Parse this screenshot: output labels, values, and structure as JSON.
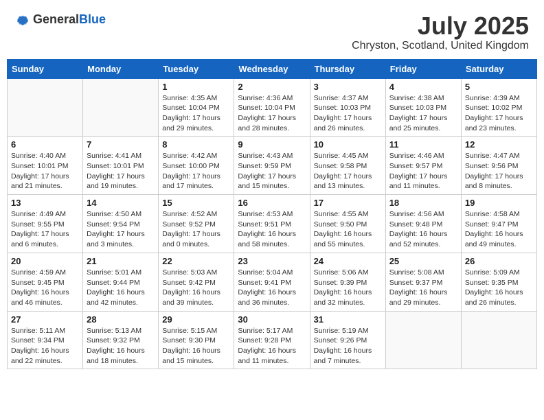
{
  "header": {
    "logo_general": "General",
    "logo_blue": "Blue",
    "title": "July 2025",
    "location": "Chryston, Scotland, United Kingdom"
  },
  "days_of_week": [
    "Sunday",
    "Monday",
    "Tuesday",
    "Wednesday",
    "Thursday",
    "Friday",
    "Saturday"
  ],
  "weeks": [
    [
      {
        "day": "",
        "info": ""
      },
      {
        "day": "",
        "info": ""
      },
      {
        "day": "1",
        "info": "Sunrise: 4:35 AM\nSunset: 10:04 PM\nDaylight: 17 hours and 29 minutes."
      },
      {
        "day": "2",
        "info": "Sunrise: 4:36 AM\nSunset: 10:04 PM\nDaylight: 17 hours and 28 minutes."
      },
      {
        "day": "3",
        "info": "Sunrise: 4:37 AM\nSunset: 10:03 PM\nDaylight: 17 hours and 26 minutes."
      },
      {
        "day": "4",
        "info": "Sunrise: 4:38 AM\nSunset: 10:03 PM\nDaylight: 17 hours and 25 minutes."
      },
      {
        "day": "5",
        "info": "Sunrise: 4:39 AM\nSunset: 10:02 PM\nDaylight: 17 hours and 23 minutes."
      }
    ],
    [
      {
        "day": "6",
        "info": "Sunrise: 4:40 AM\nSunset: 10:01 PM\nDaylight: 17 hours and 21 minutes."
      },
      {
        "day": "7",
        "info": "Sunrise: 4:41 AM\nSunset: 10:01 PM\nDaylight: 17 hours and 19 minutes."
      },
      {
        "day": "8",
        "info": "Sunrise: 4:42 AM\nSunset: 10:00 PM\nDaylight: 17 hours and 17 minutes."
      },
      {
        "day": "9",
        "info": "Sunrise: 4:43 AM\nSunset: 9:59 PM\nDaylight: 17 hours and 15 minutes."
      },
      {
        "day": "10",
        "info": "Sunrise: 4:45 AM\nSunset: 9:58 PM\nDaylight: 17 hours and 13 minutes."
      },
      {
        "day": "11",
        "info": "Sunrise: 4:46 AM\nSunset: 9:57 PM\nDaylight: 17 hours and 11 minutes."
      },
      {
        "day": "12",
        "info": "Sunrise: 4:47 AM\nSunset: 9:56 PM\nDaylight: 17 hours and 8 minutes."
      }
    ],
    [
      {
        "day": "13",
        "info": "Sunrise: 4:49 AM\nSunset: 9:55 PM\nDaylight: 17 hours and 6 minutes."
      },
      {
        "day": "14",
        "info": "Sunrise: 4:50 AM\nSunset: 9:54 PM\nDaylight: 17 hours and 3 minutes."
      },
      {
        "day": "15",
        "info": "Sunrise: 4:52 AM\nSunset: 9:52 PM\nDaylight: 17 hours and 0 minutes."
      },
      {
        "day": "16",
        "info": "Sunrise: 4:53 AM\nSunset: 9:51 PM\nDaylight: 16 hours and 58 minutes."
      },
      {
        "day": "17",
        "info": "Sunrise: 4:55 AM\nSunset: 9:50 PM\nDaylight: 16 hours and 55 minutes."
      },
      {
        "day": "18",
        "info": "Sunrise: 4:56 AM\nSunset: 9:48 PM\nDaylight: 16 hours and 52 minutes."
      },
      {
        "day": "19",
        "info": "Sunrise: 4:58 AM\nSunset: 9:47 PM\nDaylight: 16 hours and 49 minutes."
      }
    ],
    [
      {
        "day": "20",
        "info": "Sunrise: 4:59 AM\nSunset: 9:45 PM\nDaylight: 16 hours and 46 minutes."
      },
      {
        "day": "21",
        "info": "Sunrise: 5:01 AM\nSunset: 9:44 PM\nDaylight: 16 hours and 42 minutes."
      },
      {
        "day": "22",
        "info": "Sunrise: 5:03 AM\nSunset: 9:42 PM\nDaylight: 16 hours and 39 minutes."
      },
      {
        "day": "23",
        "info": "Sunrise: 5:04 AM\nSunset: 9:41 PM\nDaylight: 16 hours and 36 minutes."
      },
      {
        "day": "24",
        "info": "Sunrise: 5:06 AM\nSunset: 9:39 PM\nDaylight: 16 hours and 32 minutes."
      },
      {
        "day": "25",
        "info": "Sunrise: 5:08 AM\nSunset: 9:37 PM\nDaylight: 16 hours and 29 minutes."
      },
      {
        "day": "26",
        "info": "Sunrise: 5:09 AM\nSunset: 9:35 PM\nDaylight: 16 hours and 26 minutes."
      }
    ],
    [
      {
        "day": "27",
        "info": "Sunrise: 5:11 AM\nSunset: 9:34 PM\nDaylight: 16 hours and 22 minutes."
      },
      {
        "day": "28",
        "info": "Sunrise: 5:13 AM\nSunset: 9:32 PM\nDaylight: 16 hours and 18 minutes."
      },
      {
        "day": "29",
        "info": "Sunrise: 5:15 AM\nSunset: 9:30 PM\nDaylight: 16 hours and 15 minutes."
      },
      {
        "day": "30",
        "info": "Sunrise: 5:17 AM\nSunset: 9:28 PM\nDaylight: 16 hours and 11 minutes."
      },
      {
        "day": "31",
        "info": "Sunrise: 5:19 AM\nSunset: 9:26 PM\nDaylight: 16 hours and 7 minutes."
      },
      {
        "day": "",
        "info": ""
      },
      {
        "day": "",
        "info": ""
      }
    ]
  ]
}
